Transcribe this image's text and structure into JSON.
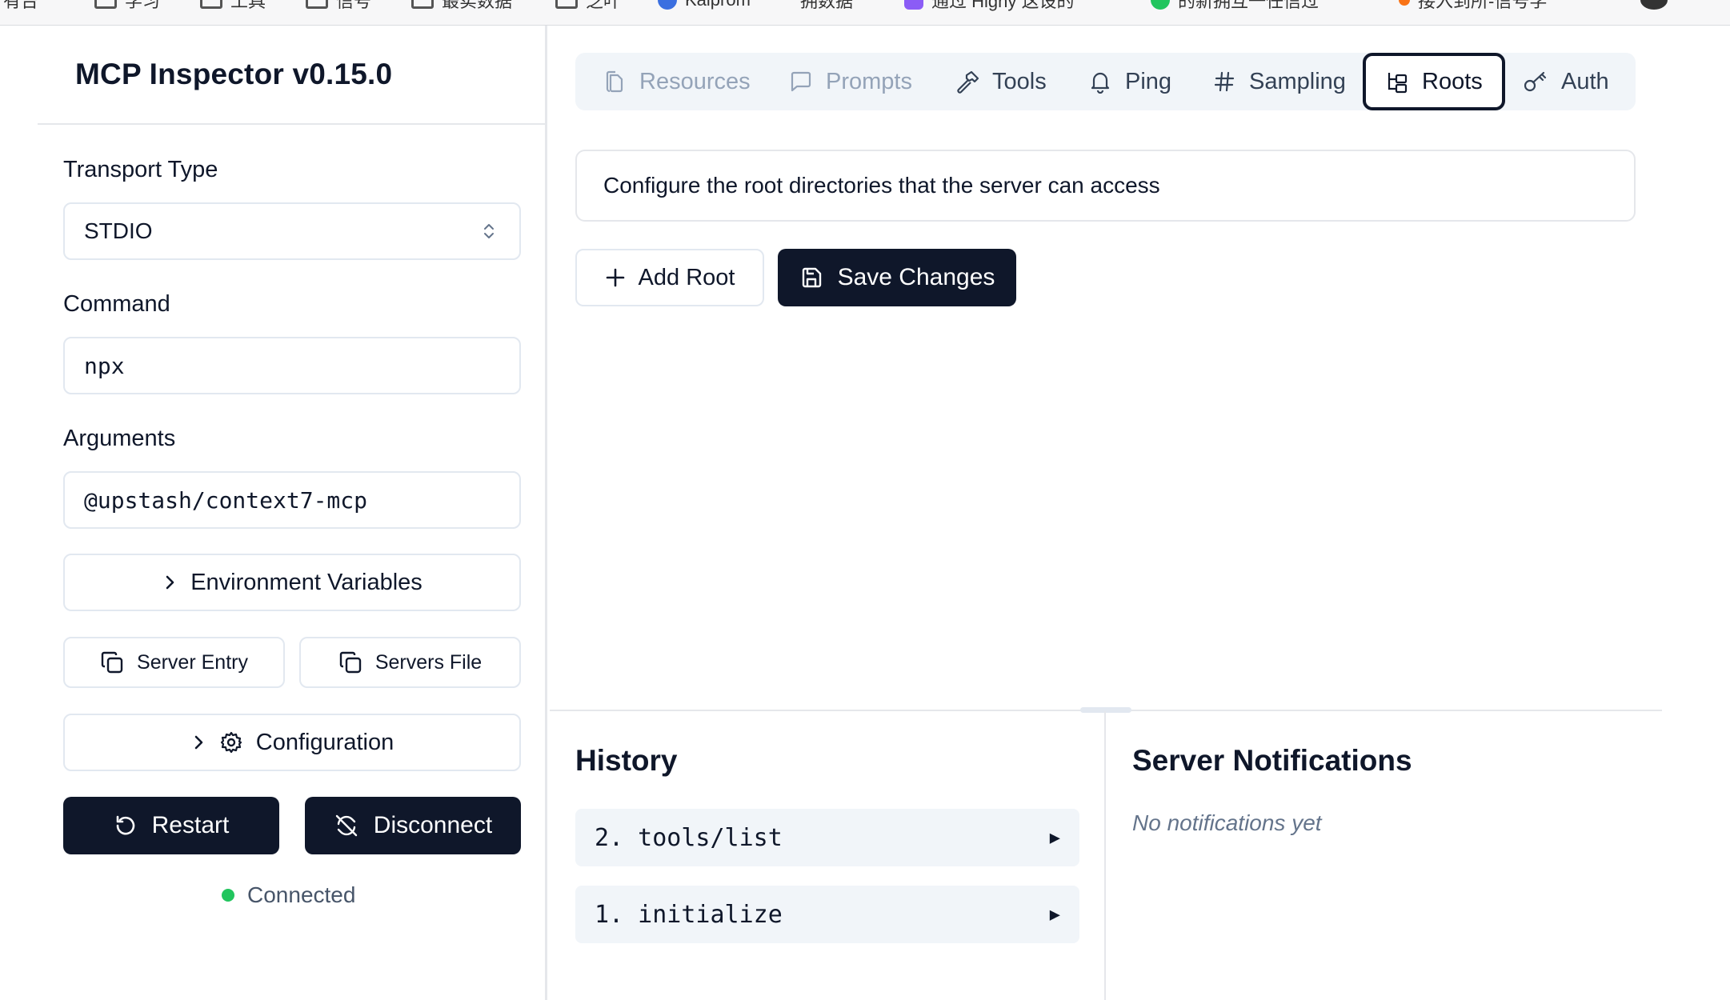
{
  "browser": {
    "bookmarks": [
      "有台",
      "学习",
      "工具",
      "信号",
      "最实数据",
      "芝叶",
      "Kaiprom",
      "拥数据",
      "通过 Highy 这设的",
      "的新拥互一任信过",
      "接入到所-信号学"
    ]
  },
  "sidebar": {
    "app_title": "MCP Inspector v0.15.0",
    "transport_label": "Transport Type",
    "transport_value": "STDIO",
    "command_label": "Command",
    "command_value": "npx",
    "arguments_label": "Arguments",
    "arguments_value": "@upstash/context7-mcp",
    "env_button": "Environment Variables",
    "server_entry_button": "Server Entry",
    "servers_file_button": "Servers File",
    "configuration_button": "Configuration",
    "restart_button": "Restart",
    "disconnect_button": "Disconnect",
    "status": "Connected",
    "status_color": "#22c55e"
  },
  "tabs": [
    {
      "label": "Resources",
      "icon": "files-icon",
      "state": "disabled"
    },
    {
      "label": "Prompts",
      "icon": "message-square-icon",
      "state": "disabled"
    },
    {
      "label": "Tools",
      "icon": "hammer-icon",
      "state": "enabled"
    },
    {
      "label": "Ping",
      "icon": "bell-icon",
      "state": "enabled"
    },
    {
      "label": "Sampling",
      "icon": "hash-icon",
      "state": "enabled"
    },
    {
      "label": "Roots",
      "icon": "folder-tree-icon",
      "state": "active"
    },
    {
      "label": "Auth",
      "icon": "key-icon",
      "state": "enabled"
    }
  ],
  "roots": {
    "description": "Configure the root directories that the server can access",
    "add_button": "Add Root",
    "save_button": "Save Changes"
  },
  "history": {
    "title": "History",
    "items": [
      {
        "label": "2. tools/list",
        "expand_glyph": "▶"
      },
      {
        "label": "1. initialize",
        "expand_glyph": "▶"
      }
    ]
  },
  "notifications": {
    "title": "Server Notifications",
    "empty_text": "No notifications yet"
  },
  "colors": {
    "primary": "#0f172a",
    "border": "#e2e8f0",
    "muted": "#94a3b8",
    "tab_bg": "#f1f5f9"
  }
}
